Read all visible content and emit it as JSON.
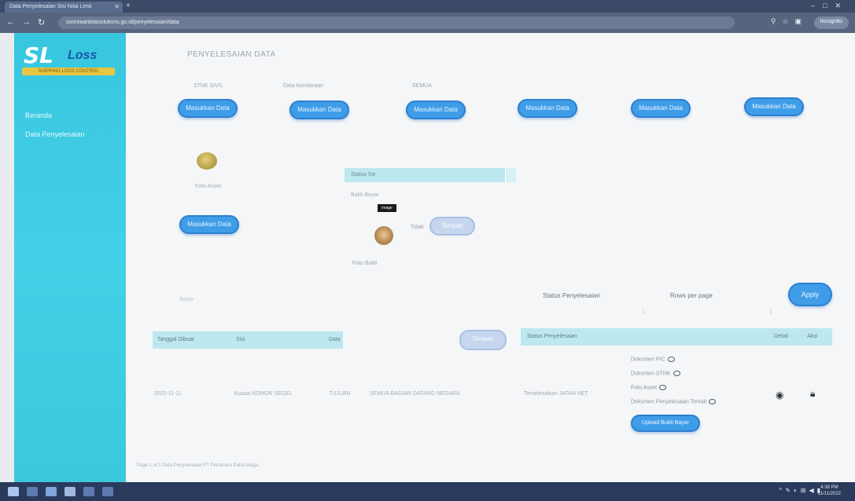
{
  "browser": {
    "tab_title": "Data Penyelesaian Sisi Nilai Limit",
    "url": "ssoniwanlelasolutions.go.id/penyelesaian/data",
    "profile": "Incognito"
  },
  "sidebar": {
    "logo_main": "SL",
    "logo_sub": "Loss",
    "logo_tag": "SHIPPING LOSS CONTROL",
    "items": [
      "Beranda",
      "Data Penyelesaian"
    ]
  },
  "page": {
    "title": "PENYELESAIAN DATA",
    "columns": [
      {
        "label": "STNK SIVIL"
      },
      {
        "label": "Data Kendaraan"
      },
      {
        "label": "SEMUA"
      },
      {
        "label": ""
      },
      {
        "label": ""
      },
      {
        "label": ""
      }
    ],
    "button_label": "Masukkan Data",
    "image_caption_left": "Foto Asset",
    "second_button_label": "Masukkan Data",
    "status": {
      "header": "Status Sie",
      "sub": "Bukti Bayar",
      "chip": "image",
      "ratio_label": "Tidak",
      "ghost_button": "Simpan",
      "caption": "Foto Bukti"
    }
  },
  "filters": {
    "search_label": "Bayar",
    "status_label": "Status Penyelesaian",
    "rows_label": "Rows per page",
    "status_value": "1",
    "rows_value": "1",
    "apply_label": "Apply"
  },
  "table_left": {
    "headers": [
      "Tanggal Dibuat",
      "Sisi",
      "Data"
    ],
    "row": [
      "2022-11-11",
      "Kuasa NOMOR SEGEL",
      "TUJUAN",
      "SEMUA BAGIAN DATANG NEGARA"
    ],
    "ghost_button": "Simpan"
  },
  "table_right": {
    "headers": [
      "Status Penyelesaian",
      "Detail",
      "Aksi"
    ],
    "status_value": "Terselesaikan JATAH NET",
    "documents": [
      "Dokumen PIC",
      "Dokumen STNK",
      "Foto Asset",
      "Dokumen Penyelesaian Terkait"
    ],
    "upload_label": "Upload Bukti Bayar"
  },
  "footer": "Page 1 of 1 Data Penyelesaian PT Pertamina Patra Niaga",
  "taskbar": {
    "time": "4:38 PM",
    "date": "11/11/2022"
  }
}
